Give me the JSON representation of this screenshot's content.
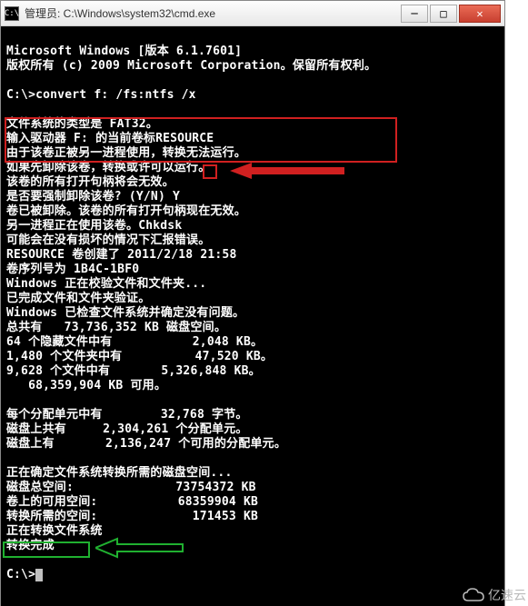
{
  "window": {
    "title": "管理员: C:\\Windows\\system32\\cmd.exe",
    "minimize": "─",
    "maximize": "□",
    "close": "✕"
  },
  "console": {
    "header1": "Microsoft Windows [版本 6.1.7601]",
    "header2": "版权所有 (c) 2009 Microsoft Corporation。保留所有权利。",
    "prompt1": "C:\\>convert f: /fs:ntfs /x",
    "fs_type": "文件系统的类型是 FAT32。",
    "enter_label": "输入驱动器 F: 的当前卷标RESOURCE",
    "red1": "由于该卷正被另一进程使用，转换无法运行。",
    "red2": "如果先卸除该卷，转换或许可以运行。",
    "red3": "该卷的所有打开句柄将会无效。",
    "force": "是否要强制卸除该卷? (Y/N) Y",
    "dismounted": "卷已被卸除。该卷的所有打开句柄现在无效。",
    "another": "另一进程正在使用该卷。Chkdsk",
    "maybe_err": "可能会在没有损坏的情况下汇报错误。",
    "created": "RESOURCE 卷创建了 2011/2/18 21:58",
    "serial": "卷序列号为 1B4C-1BF0",
    "verify_ff": "Windows 正在校验文件和文件夹...",
    "verify_done": "已完成文件和文件夹验证。",
    "chk_ok": "Windows 已检查文件系统并确定没有问题。",
    "total_kb": "总共有   73,736,352 KB 磁盘空间。",
    "hidden": "64 个隐藏文件中有           2,048 KB。",
    "folders": "1,480 个文件夹中有          47,520 KB。",
    "files": "9,628 个文件中有       5,326,848 KB。",
    "avail1": "   68,359,904 KB 可用。",
    "alloc": "每个分配单元中有        32,768 字节。",
    "disk_alloc": "磁盘上共有     2,304,261 个分配单元。",
    "disk_free": "磁盘上有       2,136,247 个可用的分配单元。",
    "determining": "正在确定文件系统转换所需的磁盘空间...",
    "total_space": "磁盘总空间:              73754372 KB",
    "free_space": "卷上的可用空间:           68359904 KB",
    "need_space": "转换所需的空间:             171453 KB",
    "converting": "正在转换文件系统",
    "done": "转换完成",
    "prompt2": "C:\\>"
  },
  "watermark": {
    "text": "亿速云"
  }
}
